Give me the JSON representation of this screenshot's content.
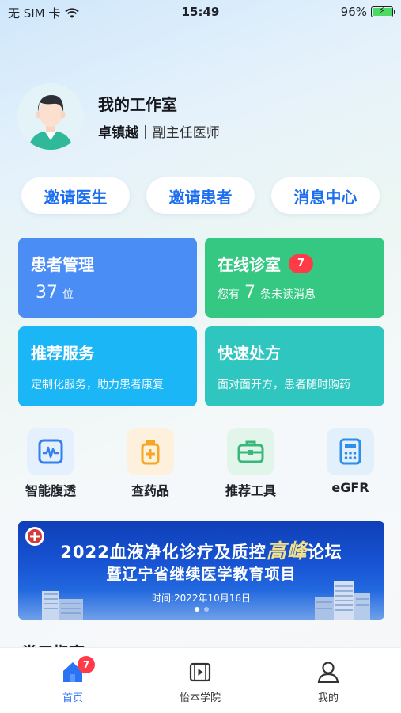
{
  "status_bar": {
    "carrier": "无 SIM 卡",
    "time": "15:49",
    "battery": "96%",
    "battery_level": 0.96
  },
  "profile": {
    "title": "我的工作室",
    "name": "卓镇越",
    "separator": "|",
    "role": "副主任医师"
  },
  "actions": [
    {
      "label": "邀请医生"
    },
    {
      "label": "邀请患者"
    },
    {
      "label": "消息中心"
    }
  ],
  "cards": {
    "patients": {
      "title": "患者管理",
      "count": "37",
      "unit": "位",
      "color": "#4a8ef5"
    },
    "clinic": {
      "title": "在线诊室",
      "badge": "7",
      "prefix": "您有",
      "count": "7",
      "suffix": "条未读消息",
      "color": "#35c882"
    },
    "services": {
      "title": "推荐服务",
      "desc": "定制化服务，助力患者康复",
      "color": "#1bb6f5"
    },
    "prescription": {
      "title": "快速处方",
      "desc": "面对面开方，患者随时购药",
      "color": "#2fc6c0"
    }
  },
  "tools": [
    {
      "label": "智能腹透",
      "icon": "dialysis-monitor-icon",
      "color": "#3580f0"
    },
    {
      "label": "查药品",
      "icon": "medicine-bottle-icon",
      "color": "#f5a623"
    },
    {
      "label": "推荐工具",
      "icon": "toolbox-icon",
      "color": "#39b979"
    },
    {
      "label": "eGFR",
      "icon": "calculator-icon",
      "color": "#2f8ee8"
    }
  ],
  "banner": {
    "line1_a": "2022血液净化诊疗及质控",
    "line1_b": "高峰",
    "line1_c": "论坛",
    "line2": "暨辽宁省继续医学教育项目",
    "date": "时间:2022年10月16日"
  },
  "section": {
    "title": "常用指南"
  },
  "tabbar": {
    "items": [
      {
        "label": "首页",
        "badge": "7",
        "icon": "home-icon"
      },
      {
        "label": "怡本学院",
        "icon": "video-icon"
      },
      {
        "label": "我的",
        "icon": "user-icon"
      }
    ]
  }
}
